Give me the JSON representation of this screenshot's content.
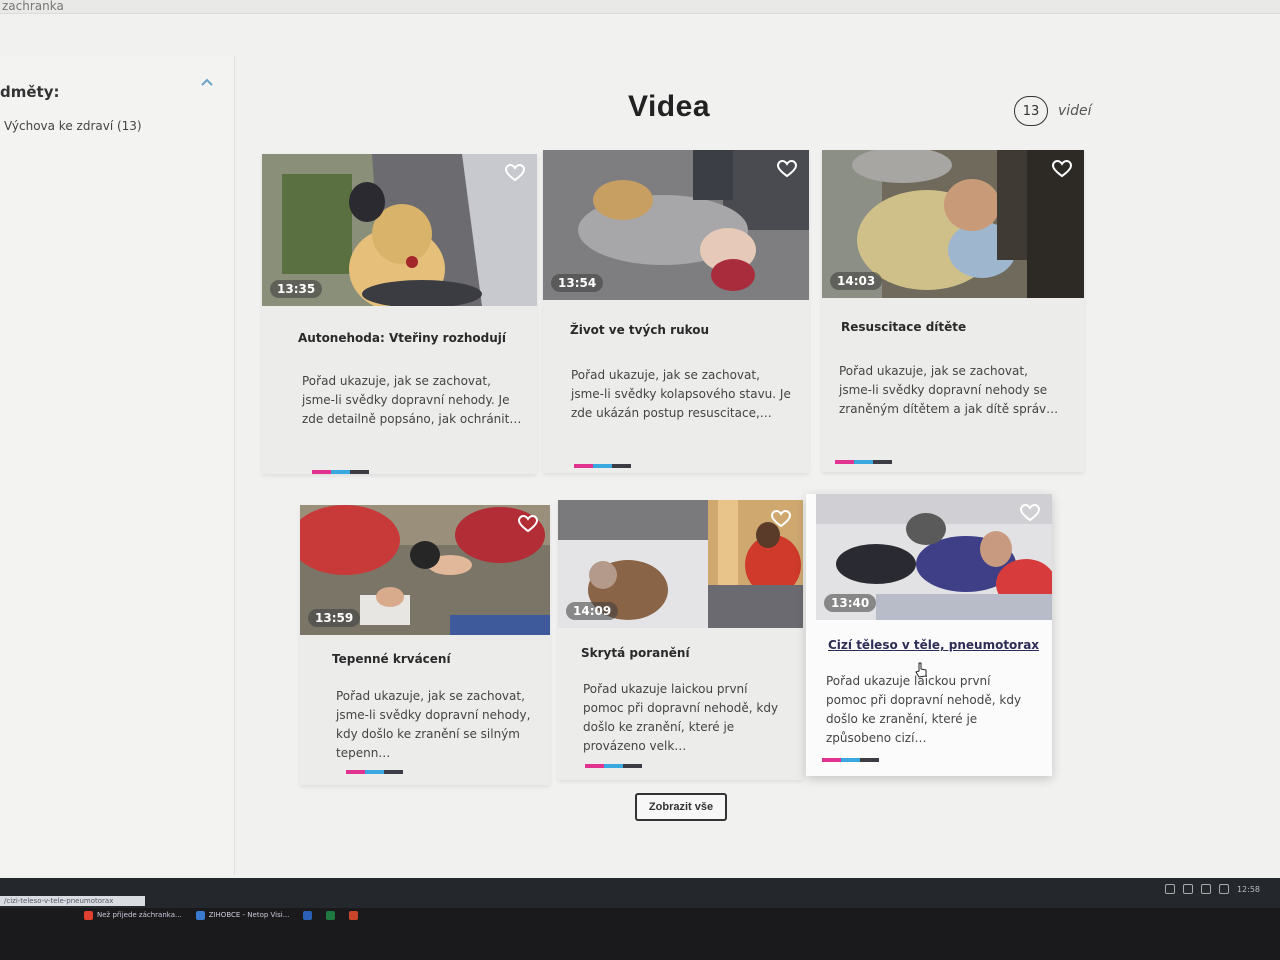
{
  "browser": {
    "url_fragment": "zachranka",
    "status_url": "/cizi-teleso-v-tele-pneumotorax"
  },
  "sidebar": {
    "title": "dměty:",
    "item": "Výchova ke zdraví (13)"
  },
  "header": {
    "title": "Videa",
    "count": "13",
    "count_label": "videí"
  },
  "colors": {
    "tag_pink": "#e0338f",
    "tag_blue": "#3aa7e0",
    "tag_dark": "#3c3c44"
  },
  "videos": [
    {
      "title": "Autonehoda: Vteřiny rozhodují",
      "duration": "13:35",
      "desc": "Pořad ukazuje, jak se zachovat, jsme-li svědky dopravní nehody. Je zde detailně popsáno, jak ochránit…"
    },
    {
      "title": "Život ve tvých rukou",
      "duration": "13:54",
      "desc": "Pořad ukazuje, jak se zachovat, jsme-li svědky kolapsového stavu. Je zde ukázán postup resuscitace,…"
    },
    {
      "title": "Resuscitace dítěte",
      "duration": "14:03",
      "desc": "Pořad ukazuje, jak se zachovat, jsme-li svědky dopravní nehody se zraněným dítětem a jak dítě správ…"
    },
    {
      "title": "Tepenné krvácení",
      "duration": "13:59",
      "desc": "Pořad ukazuje, jak se zachovat, jsme-li svědky dopravní nehody, kdy došlo ke zranění se silným tepenn…"
    },
    {
      "title": "Skrytá poranění",
      "duration": "14:09",
      "desc": "Pořad ukazuje laickou první pomoc při dopravní nehodě, kdy došlo ke zranění, které je provázeno velk…"
    },
    {
      "title": "Cizí těleso v těle, pneumotorax",
      "duration": "13:40",
      "desc": "Pořad ukazuje laickou první pomoc při dopravní nehodě, kdy došlo ke zranění, které je způsobeno cizí…"
    }
  ],
  "show_all_label": "Zobrazit vše",
  "taskbar": {
    "items": [
      "Než přijede záchranka...",
      "ZIHOBCE - Netop Visi..."
    ],
    "clock": "12:58"
  }
}
